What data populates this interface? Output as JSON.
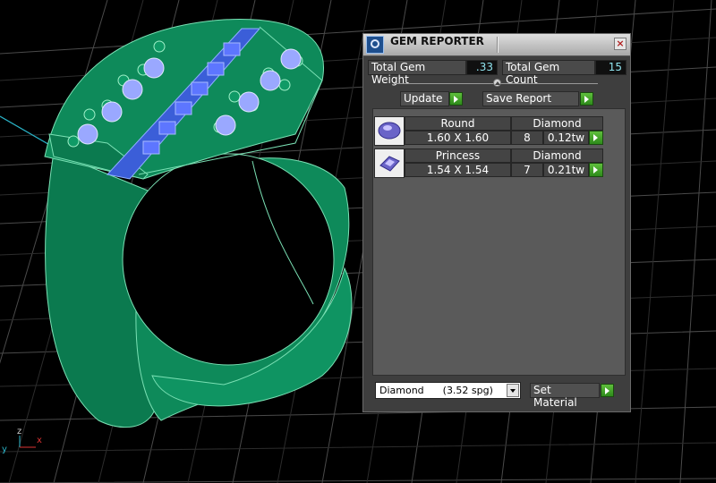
{
  "window": {
    "title": "GEM REPORTER",
    "close_glyph": "×",
    "icon": "gem-reporter-app-icon"
  },
  "stats": {
    "total_weight_label": "Total Gem Weight",
    "total_weight_value": ".33",
    "total_count_label": "Total Gem Count",
    "total_count_value": "15"
  },
  "toolbar": {
    "update_label": "Update",
    "save_report_label": "Save Report"
  },
  "gems": [
    {
      "shape": "Round",
      "size": "1.60 X 1.60",
      "material": "Diamond",
      "count": "8",
      "weight": "0.12tw",
      "icon": "round-gem-icon"
    },
    {
      "shape": "Princess",
      "size": "1.54 X 1.54",
      "material": "Diamond",
      "count": "7",
      "weight": "0.21tw",
      "icon": "princess-gem-icon"
    }
  ],
  "material": {
    "selected": "Diamond      (3.52 spg)",
    "set_label": "Set Material"
  },
  "viewport": {
    "axis_labels": {
      "x": "x",
      "y": "y",
      "z": "z"
    },
    "colors": {
      "ring": "#0e8a5a",
      "ring_edges": "#7ae0b4",
      "gems": "#5d76ff",
      "grid": "#4a4a4a",
      "x_axis": "#d33",
      "y_axis": "#2ab4c8"
    }
  }
}
